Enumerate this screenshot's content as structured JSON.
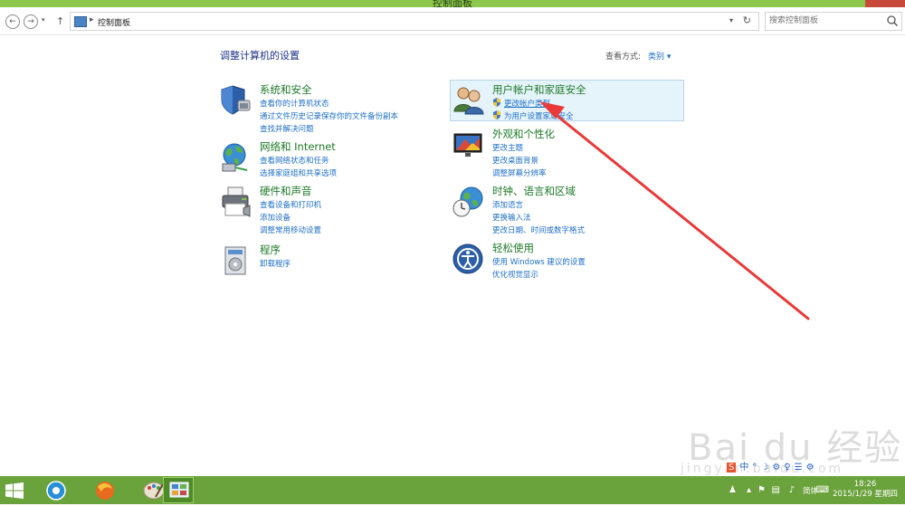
{
  "window": {
    "title": "控制面板"
  },
  "address": {
    "path": "控制面板",
    "search_placeholder": "搜索控制面板"
  },
  "heading": "调整计算机的设置",
  "viewby": {
    "label": "查看方式:",
    "value": "类别 ▾"
  },
  "categories": [
    {
      "title": "系统和安全",
      "icon": "system-security-shield-icon",
      "links": [
        "查看你的计算机状态",
        "通过文件历史记录保存你的文件备份副本",
        "查找并解决问题"
      ]
    },
    {
      "title": "网络和 Internet",
      "icon": "network-globe-icon",
      "links": [
        "查看网络状态和任务",
        "选择家庭组和共享选项"
      ]
    },
    {
      "title": "硬件和声音",
      "icon": "printer-icon",
      "links": [
        "查看设备和打印机",
        "添加设备",
        "调整常用移动设置"
      ]
    },
    {
      "title": "程序",
      "icon": "programs-icon",
      "links": [
        "卸载程序"
      ]
    },
    {
      "title": "用户帐户和家庭安全",
      "icon": "user-accounts-icon",
      "links": [
        "更改帐户类型",
        "为用户设置家庭安全"
      ]
    },
    {
      "title": "外观和个性化",
      "icon": "appearance-monitor-icon",
      "links": [
        "更改主题",
        "更改桌面背景",
        "调整屏幕分辨率"
      ]
    },
    {
      "title": "时钟、语言和区域",
      "icon": "clock-globe-icon",
      "links": [
        "添加语言",
        "更换输入法",
        "更改日期、时间或数字格式"
      ]
    },
    {
      "title": "轻松使用",
      "icon": "ease-of-access-icon",
      "links": [
        "使用 Windows 建议的设置",
        "优化视觉显示"
      ]
    }
  ],
  "imebar": [
    "S",
    "中",
    "°",
    "☽",
    "⚙",
    "♀",
    "☰",
    "⚙"
  ],
  "watermark": {
    "main": "Bai du 经验",
    "sub": "jingyan.baidu.com"
  },
  "taskbar": {
    "ime": "简体",
    "time": "18:26",
    "date": "2015/1/29 星期四"
  },
  "colors": {
    "accent": "#8cc84b",
    "link": "#1e6fc8",
    "category": "#1e7a28",
    "arrow": "#e83a3a"
  }
}
